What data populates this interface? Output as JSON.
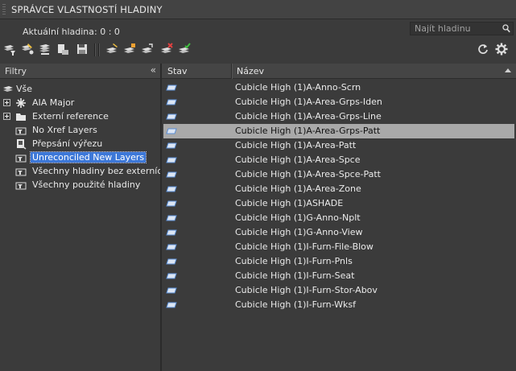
{
  "title": "SPRÁVCE VLASTNOSTÍ HLADINY",
  "current_layer": "Aktuální hladina: 0 : 0",
  "search": {
    "placeholder": "Najít hladinu"
  },
  "filters": {
    "header": "Filtry",
    "collapse": "«",
    "items": [
      {
        "label": "Vše",
        "icon": "layers-stack-icon"
      },
      {
        "label": "AIA Major",
        "icon": "filter-tree-icon"
      },
      {
        "label": "Externí reference",
        "icon": "xref-folder-icon"
      },
      {
        "label": "No Xref Layers",
        "icon": "property-filter-icon"
      },
      {
        "label": "Přepsání výřezu",
        "icon": "viewport-override-icon"
      },
      {
        "label": "Unreconciled New Layers",
        "icon": "property-filter-icon",
        "selected": true
      },
      {
        "label": "Všechny hladiny bez externích",
        "icon": "property-filter-icon"
      },
      {
        "label": "Všechny použité hladiny",
        "icon": "property-filter-icon"
      }
    ]
  },
  "table": {
    "col_status": "Stav",
    "col_name": "Název",
    "rows": [
      "Cubicle High (1)A-Anno-Scrn",
      "Cubicle High (1)A-Area-Grps-Iden",
      "Cubicle High (1)A-Area-Grps-Line",
      "Cubicle High (1)A-Area-Grps-Patt",
      "Cubicle High (1)A-Area-Patt",
      "Cubicle High (1)A-Area-Spce",
      "Cubicle High (1)A-Area-Spce-Patt",
      "Cubicle High (1)A-Area-Zone",
      "Cubicle High (1)ASHADE",
      "Cubicle High (1)G-Anno-Nplt",
      "Cubicle High (1)G-Anno-View",
      "Cubicle High (1)I-Furn-File-Blow",
      "Cubicle High (1)I-Furn-Pnls",
      "Cubicle High (1)I-Furn-Seat",
      "Cubicle High (1)I-Furn-Stor-Abov",
      "Cubicle High (1)I-Furn-Wksf"
    ],
    "selected_index": 3
  },
  "colors": {
    "selection": "#3d78d8",
    "row_selected": "#a9a9a9",
    "status_icon": "#5b8fd6"
  }
}
